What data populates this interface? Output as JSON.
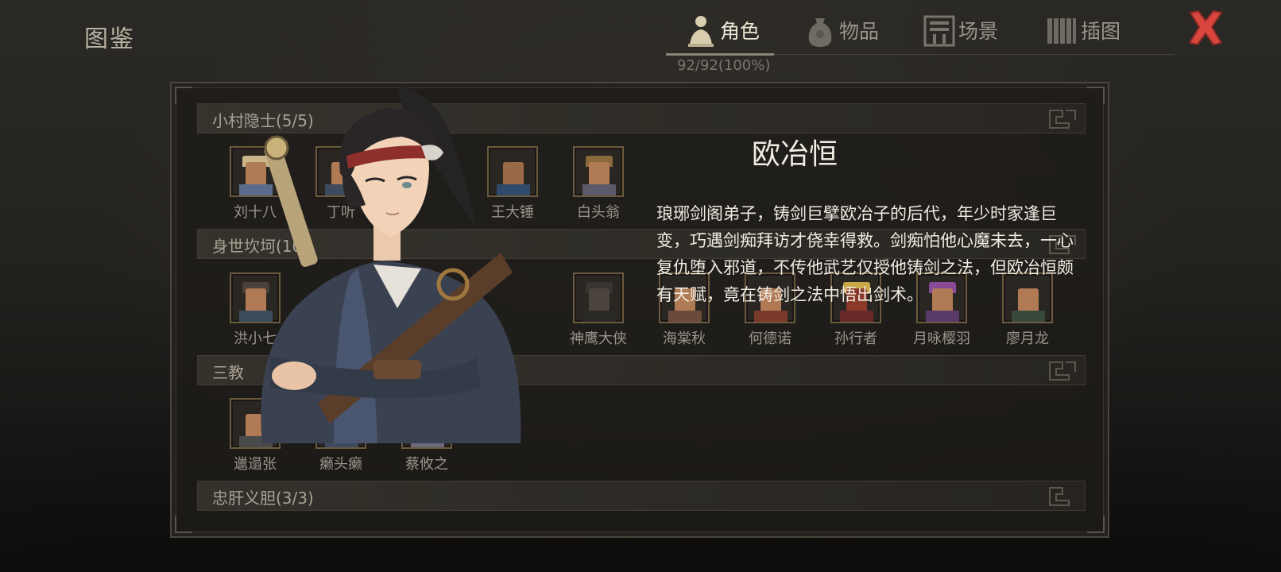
{
  "page_title": "图鉴",
  "tabs": [
    {
      "label": "角色",
      "icon": "character-icon",
      "active": true
    },
    {
      "label": "物品",
      "icon": "item-bag-icon",
      "active": false
    },
    {
      "label": "场景",
      "icon": "scene-gate-icon",
      "active": false
    },
    {
      "label": "插图",
      "icon": "illustration-scroll-icon",
      "active": false
    }
  ],
  "progress": "92/92(100%)",
  "close_icon": "close-icon",
  "sections": [
    {
      "title": "小村隐士(5/5)",
      "characters": [
        "刘十八",
        "丁听",
        "",
        "王大锤",
        "白头翁"
      ]
    },
    {
      "title": "身世坎坷(10/",
      "characters": [
        "洪小七",
        "",
        "",
        "",
        "神鹰大侠",
        "海棠秋",
        "何德诺",
        "孙行者",
        "月咏樱羽",
        "廖月龙"
      ]
    },
    {
      "title": "三教",
      "characters": [
        "邋遢张",
        "癞头癞",
        "蔡攸之"
      ]
    },
    {
      "title": "忠肝义胆(3/3)",
      "characters": []
    }
  ],
  "detail": {
    "name": "欧冶恒",
    "description": "琅琊剑阁弟子，铸剑巨擘欧冶子的后代，年少时家逢巨变，巧遇剑痴拜访才侥幸得救。剑痴怕他心魔未去，一心复仇堕入邪道，不传他武艺仅授他铸剑之法，但欧冶恒颇有天赋，竟在铸剑之法中悟出剑术。"
  },
  "colors": {
    "accent_close": "#d9463d",
    "portrait_frame": "#6b5a3e"
  }
}
